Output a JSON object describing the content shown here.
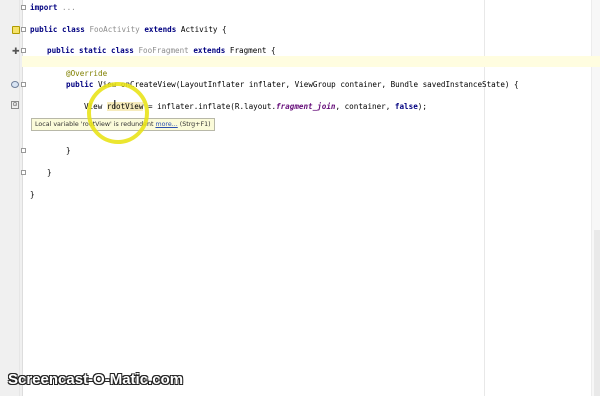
{
  "editor": {
    "lines": {
      "import": {
        "kw": "import",
        "rest": " ..."
      },
      "class_decl": {
        "kw1": "public class",
        "name": " FooActivity ",
        "kw2": "extends",
        "parent": " Activity {"
      },
      "frag_decl": {
        "kw1": "public static class",
        "name": " FooFragment ",
        "kw2": "extends",
        "parent": " Fragment {"
      },
      "override": "@Override",
      "method_decl": {
        "kw": "public",
        "rest": " View onCreateView(LayoutInflater inflater, ViewGroup container, Bundle savedInstanceState) {"
      },
      "body": {
        "type": "View ",
        "var": "rootView",
        "mid": " = inflater.inflate(R.layout.",
        "field": "fragment_join",
        "mid2": ", container, ",
        "kw": "false",
        "end": ");"
      },
      "close_method": "}",
      "close_frag": "}",
      "close_class": "}"
    },
    "tooltip": {
      "text": "Local variable 'rootView' is redundant",
      "link": "more...",
      "shortcut": " (Strg+F1)"
    }
  },
  "gutter_icons": [
    "breakpoint-icon",
    "generic-icon",
    "override-icon",
    "implement-icon"
  ],
  "watermark": "Screencast-O-Matic.com",
  "colors": {
    "keyword": "#000080",
    "unused": "#8c8c8c",
    "annotation": "#808000",
    "field": "#660e7a",
    "highlight_ring": "#e9e31a",
    "tooltip_bg": "#fbfbd9"
  }
}
